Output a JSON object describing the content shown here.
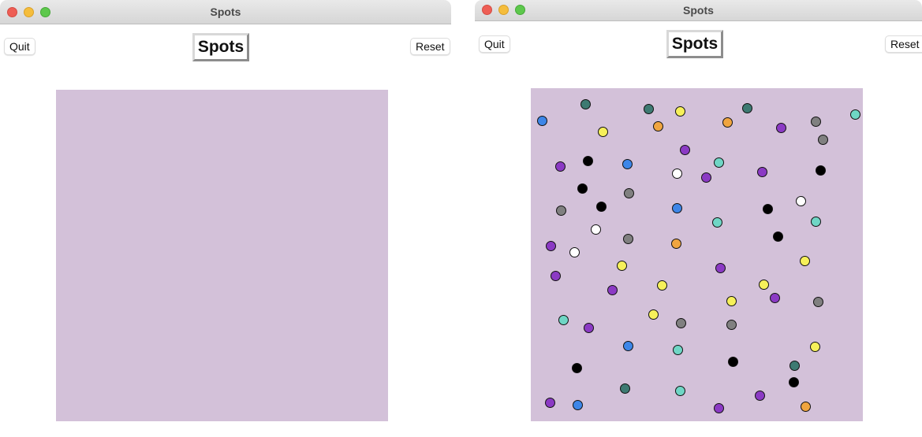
{
  "windows": [
    {
      "id": "left",
      "title": "Spots",
      "quit_label": "Quit",
      "heading": "Spots",
      "reset_label": "Reset",
      "canvas_color": "#d3c1d9",
      "spots": []
    },
    {
      "id": "right",
      "title": "Spots",
      "quit_label": "Quit",
      "heading": "Spots",
      "reset_label": "Reset",
      "canvas_color": "#d3c1d9",
      "spot_colors": {
        "teal": "#3d7a72",
        "aqua": "#6fd6c5",
        "yellow": "#f6f05a",
        "orange": "#f0a540",
        "purple": "#8b3ac4",
        "black": "#000000",
        "gray": "#808080",
        "blue": "#3d86e8",
        "white": "#ffffff"
      },
      "spots": [
        {
          "color": "teal"
        },
        {
          "color": "teal"
        },
        {
          "color": "yellow"
        },
        {
          "color": "teal"
        },
        {
          "color": "aqua"
        },
        {
          "color": "blue"
        },
        {
          "color": "yellow"
        },
        {
          "color": "orange"
        },
        {
          "color": "orange"
        },
        {
          "color": "purple"
        },
        {
          "color": "gray"
        },
        {
          "color": "gray"
        },
        {
          "color": "purple"
        },
        {
          "color": "purple"
        },
        {
          "color": "black"
        },
        {
          "color": "blue"
        },
        {
          "color": "white"
        },
        {
          "color": "aqua"
        },
        {
          "color": "purple"
        },
        {
          "color": "purple"
        },
        {
          "color": "black"
        },
        {
          "color": "black"
        },
        {
          "color": "gray"
        },
        {
          "color": "gray"
        },
        {
          "color": "black"
        },
        {
          "color": "blue"
        },
        {
          "color": "black"
        },
        {
          "color": "white"
        },
        {
          "color": "aqua"
        },
        {
          "color": "aqua"
        },
        {
          "color": "white"
        },
        {
          "color": "gray"
        },
        {
          "color": "black"
        },
        {
          "color": "purple"
        },
        {
          "color": "orange"
        },
        {
          "color": "white"
        },
        {
          "color": "yellow"
        },
        {
          "color": "purple"
        },
        {
          "color": "yellow"
        },
        {
          "color": "purple"
        },
        {
          "color": "yellow"
        },
        {
          "color": "yellow"
        },
        {
          "color": "purple"
        },
        {
          "color": "yellow"
        },
        {
          "color": "purple"
        },
        {
          "color": "gray"
        },
        {
          "color": "yellow"
        },
        {
          "color": "aqua"
        },
        {
          "color": "gray"
        },
        {
          "color": "gray"
        },
        {
          "color": "purple"
        },
        {
          "color": "blue"
        },
        {
          "color": "aqua"
        },
        {
          "color": "yellow"
        },
        {
          "color": "black"
        },
        {
          "color": "black"
        },
        {
          "color": "teal"
        },
        {
          "color": "teal"
        },
        {
          "color": "black"
        },
        {
          "color": "aqua"
        },
        {
          "color": "purple"
        },
        {
          "color": "blue"
        },
        {
          "color": "purple"
        },
        {
          "color": "purple"
        },
        {
          "color": "orange"
        }
      ]
    }
  ]
}
